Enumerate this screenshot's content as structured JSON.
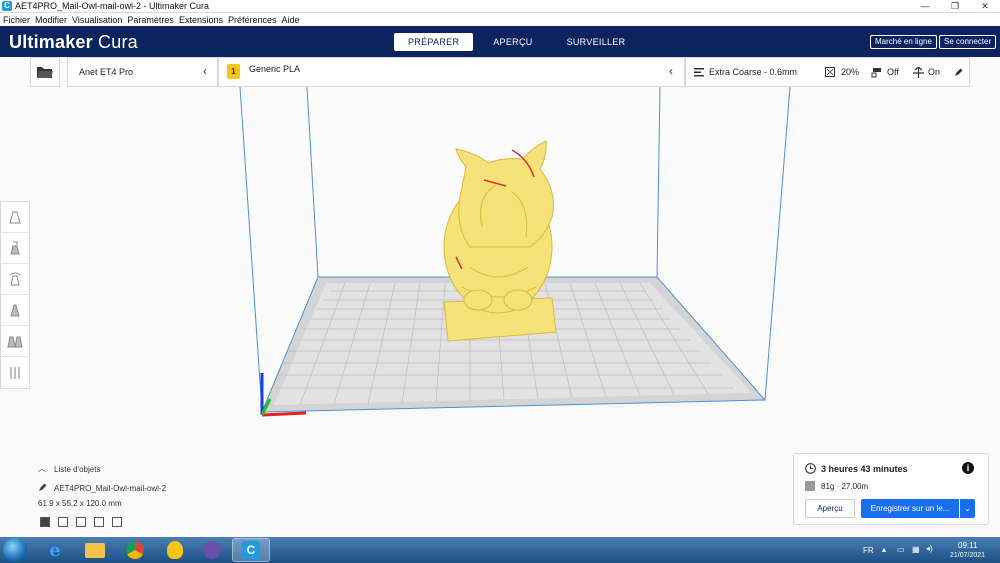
{
  "window": {
    "title": "AET4PRO_Mail-Owl-mail-owl-2 - Ultimaker Cura",
    "minimize": "—",
    "maximize": "❐",
    "close": "✕"
  },
  "menu": [
    "Fichier",
    "Modifier",
    "Visualisation",
    "Paramètres",
    "Extensions",
    "Préférences",
    "Aide"
  ],
  "header": {
    "brand_main": "Ultimaker",
    "brand_sub": "Cura",
    "stages": [
      "PRÉPARER",
      "APERÇU",
      "SURVEILLER"
    ],
    "marketplace": "Marché en ligne",
    "signin": "Se connecter"
  },
  "toolbar": {
    "printer": "Anet ET4 Pro",
    "material": "Generic PLA",
    "profile": "Extra Coarse - 0.6mm",
    "infill": "20%",
    "support": "Off",
    "adhesion": "On"
  },
  "objects": {
    "list_label": "Liste d'objets",
    "object_name": "AET4PRO_Mail-Owl-mail-owl-2",
    "dimensions": "61.9 x 55.2 x 120.0 mm"
  },
  "print": {
    "time": "3 heures 43 minutes",
    "material_usage": "81g · 27.00m",
    "preview_button": "Aperçu",
    "save_button": "Enregistrer sur un le..."
  },
  "taskbar": {
    "language": "FR",
    "time": "09:11",
    "date": "21/07/2021"
  },
  "colors": {
    "header": "#0b2460",
    "model": "#f5e37a",
    "accent": "#196ef0"
  }
}
